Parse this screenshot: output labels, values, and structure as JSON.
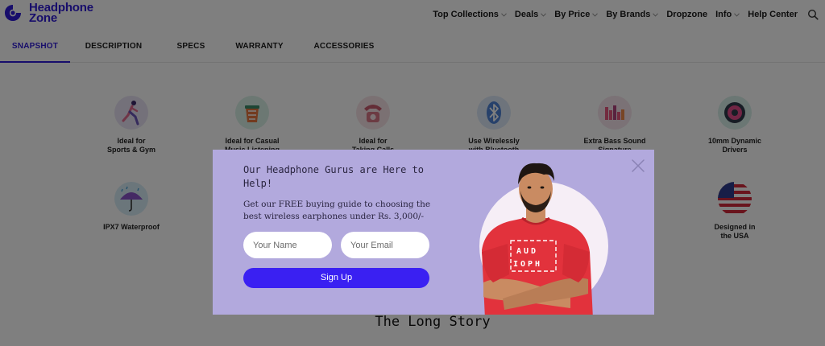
{
  "brand": {
    "line1": "Headphone",
    "line2": "Zone",
    "color": "#2f1bd6"
  },
  "nav": {
    "items": [
      {
        "label": "Top Collections",
        "dropdown": true
      },
      {
        "label": "Deals",
        "dropdown": true
      },
      {
        "label": "By Price",
        "dropdown": true
      },
      {
        "label": "By Brands",
        "dropdown": true
      },
      {
        "label": "Dropzone",
        "dropdown": false
      },
      {
        "label": "Info",
        "dropdown": true
      },
      {
        "label": "Help Center",
        "dropdown": false
      }
    ],
    "search_icon": "search-icon"
  },
  "tabs": [
    {
      "label": "SNAPSHOT",
      "active": true
    },
    {
      "label": "DESCRIPTION",
      "active": false
    },
    {
      "label": "SPECS",
      "active": false
    },
    {
      "label": "WARRANTY",
      "active": false
    },
    {
      "label": "ACCESSORIES",
      "active": false
    }
  ],
  "features": [
    {
      "label": "Ideal for\nSports & Gym",
      "icon": "running-person-icon"
    },
    {
      "label": "Ideal for Casual\nMusic Listening",
      "icon": "music-cup-icon"
    },
    {
      "label": "Ideal for\nTaking Calls",
      "icon": "telephone-icon"
    },
    {
      "label": "Use Wirelessly\nwith Bluetooth",
      "icon": "bluetooth-icon"
    },
    {
      "label": "Extra Bass Sound\nSignature",
      "icon": "equalizer-icon"
    },
    {
      "label": "10mm Dynamic\nDrivers",
      "icon": "speaker-driver-icon"
    },
    {
      "label": "IPX7 Waterproof",
      "icon": "umbrella-icon"
    },
    {
      "label": "Designed in\nthe USA",
      "icon": "usa-flag-icon"
    }
  ],
  "story": {
    "title": "The Long Story"
  },
  "modal": {
    "heading": "Our Headphone Gurus are Here to Help!",
    "text": "Get our FREE buying guide to choosing the best wireless earphones under Rs. 3,000/-",
    "name_placeholder": "Your Name",
    "email_placeholder": "Your Email",
    "signup_label": "Sign Up",
    "shirt_text": [
      "AUD",
      "IOPH"
    ],
    "close_icon": "close-icon",
    "colors": {
      "background": "#b2a9dd",
      "button": "#3a20f2",
      "shirt": "#e2323c"
    }
  }
}
